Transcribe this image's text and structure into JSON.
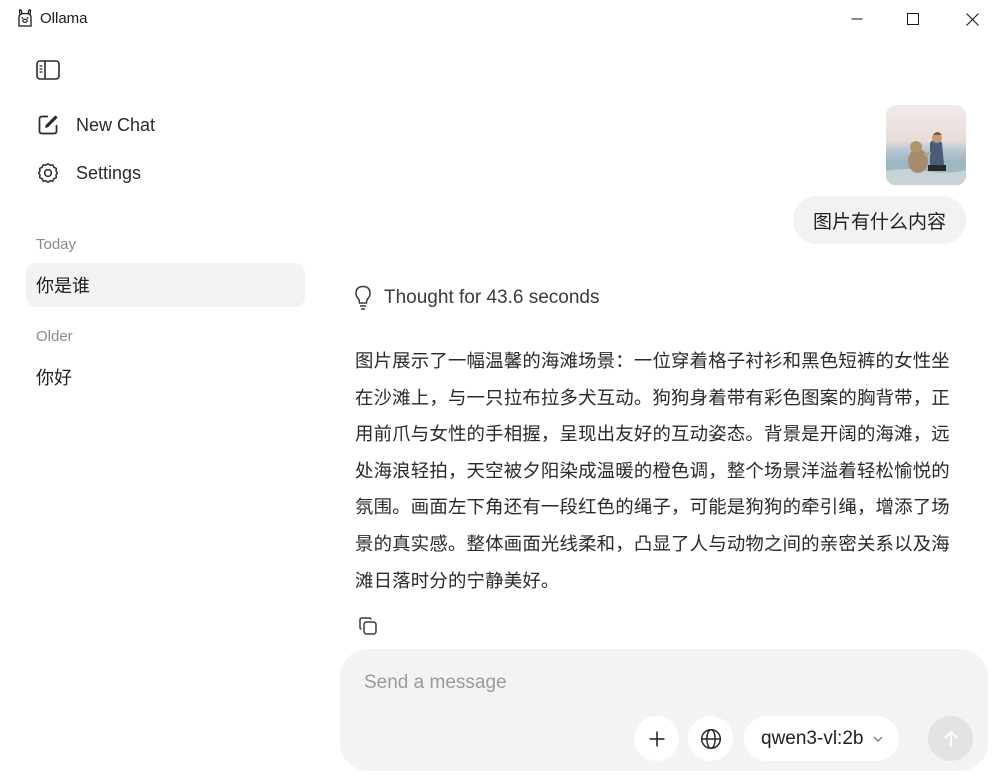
{
  "window": {
    "title": "Ollama",
    "controls": {
      "minimize": "minimize-icon",
      "maximize": "maximize-icon",
      "close": "close-icon"
    }
  },
  "sidebar": {
    "toggle_icon": "sidebar-icon",
    "nav": [
      {
        "label": "New Chat",
        "icon": "compose-icon"
      },
      {
        "label": "Settings",
        "icon": "gear-icon"
      }
    ],
    "sections": [
      {
        "label": "Today",
        "chats": [
          "你是谁"
        ]
      },
      {
        "label": "Older",
        "chats": [
          "你好"
        ]
      }
    ],
    "active_chat": "你是谁"
  },
  "conversation": {
    "user_message": {
      "image_alt": "beach photo with woman and dog",
      "text": "图片有什么内容"
    },
    "assistant": {
      "thought_label": "Thought for 43.6 seconds",
      "answer": "图片展示了一幅温馨的海滩场景：一位穿着格子衬衫和黑色短裤的女性坐在沙滩上，与一只拉布拉多犬互动。狗狗身着带有彩色图案的胸背带，正用前爪与女性的手相握，呈现出友好的互动姿态。背景是开阔的海滩，远处海浪轻拍，天空被夕阳染成温暖的橙色调，整个场景洋溢着轻松愉悦的氛围。画面左下角还有一段红色的绳子，可能是狗狗的牵引绳，增添了场景的真实感。整体画面光线柔和，凸显了人与动物之间的亲密关系以及海滩日落时分的宁静美好。",
      "copy_icon": "copy-icon"
    }
  },
  "composer": {
    "placeholder": "Send a message",
    "value": "",
    "model": "qwen3-vl:2b"
  },
  "colors": {
    "background": "#ffffff",
    "bubble": "#f2f2f2",
    "composer": "#f3f3f3",
    "send_disabled": "#e3e3e3"
  }
}
